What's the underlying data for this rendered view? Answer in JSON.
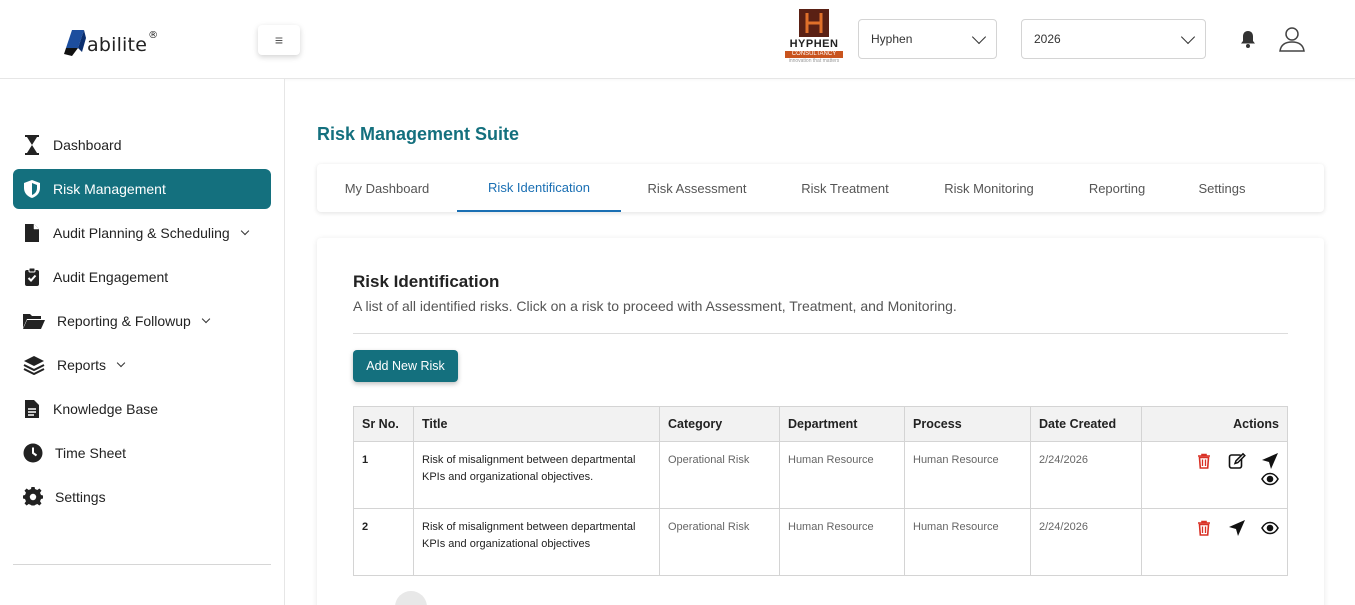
{
  "header": {
    "logo_text": "abilite",
    "logo_reg": "®",
    "menu_icon": "≡",
    "company_logo": {
      "name": "HYPHEN",
      "sub": "CONSULTANCY",
      "tag": "innovation that matters"
    },
    "company_select": "Hyphen",
    "year_select": "2026"
  },
  "sidebar": {
    "items": [
      {
        "label": "Dashboard",
        "icon": "hourglass-icon"
      },
      {
        "label": "Risk Management",
        "icon": "shield-icon",
        "active": true
      },
      {
        "label": "Audit Planning & Scheduling",
        "icon": "document-icon",
        "has_caret": true
      },
      {
        "label": "Audit Engagement",
        "icon": "clipboard-check-icon"
      },
      {
        "label": "Reporting & Followup",
        "icon": "folder-open-icon",
        "has_caret": true
      },
      {
        "label": "Reports",
        "icon": "layers-icon",
        "has_caret": true
      },
      {
        "label": "Knowledge Base",
        "icon": "document-text-icon"
      },
      {
        "label": "Time Sheet",
        "icon": "clock-icon"
      },
      {
        "label": "Settings",
        "icon": "gear-icon"
      }
    ]
  },
  "main": {
    "title": "Risk Management Suite",
    "tabs": [
      {
        "label": "My Dashboard"
      },
      {
        "label": "Risk Identification",
        "active": true
      },
      {
        "label": "Risk Assessment"
      },
      {
        "label": "Risk Treatment"
      },
      {
        "label": "Risk Monitoring"
      },
      {
        "label": "Reporting"
      },
      {
        "label": "Settings"
      }
    ],
    "card": {
      "title": "Risk Identification",
      "subtitle": "A list of all identified risks. Click on a risk to proceed with Assessment, Treatment, and Monitoring.",
      "add_button": "Add New Risk",
      "table": {
        "headers": [
          "Sr No.",
          "Title",
          "Category",
          "Department",
          "Process",
          "Date Created",
          "Actions"
        ],
        "rows": [
          {
            "sr": "1",
            "title": "Risk of misalignment between departmental KPIs and organizational objectives.",
            "category": "Operational Risk",
            "department": "Human Resource",
            "process": "Human Resource",
            "date": "2/24/2026",
            "actions": [
              "delete-icon",
              "edit-icon",
              "navigate-icon",
              "view-icon"
            ]
          },
          {
            "sr": "2",
            "title": "Risk of misalignment between departmental KPIs and organizational objectives",
            "category": "Operational Risk",
            "department": "Human Resource",
            "process": "Human Resource",
            "date": "2/24/2026",
            "actions": [
              "delete-icon",
              "navigate-icon",
              "view-icon"
            ]
          }
        ]
      }
    }
  },
  "colors": {
    "accent": "#14707e",
    "active_tab": "#1a6fb3",
    "delete": "#d93025"
  }
}
